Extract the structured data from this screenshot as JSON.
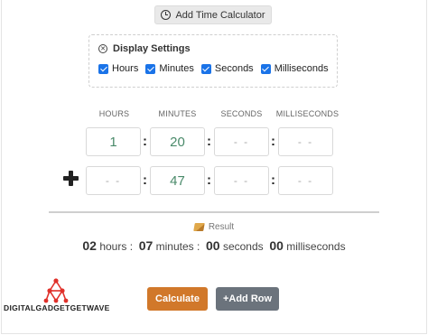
{
  "toolbar": {
    "add_time_calculator_label": "Add Time Calculator"
  },
  "settings": {
    "title": "Display Settings",
    "options": [
      {
        "label": "Hours",
        "checked": true
      },
      {
        "label": "Minutes",
        "checked": true
      },
      {
        "label": "Seconds",
        "checked": true
      },
      {
        "label": "Milliseconds",
        "checked": true
      }
    ]
  },
  "columns": [
    "HOURS",
    "MINUTES",
    "SECONDS",
    "MILLISECONDS"
  ],
  "rows": [
    {
      "operator": "",
      "hours": "1",
      "minutes": "20",
      "seconds": "- -",
      "milliseconds": "- -"
    },
    {
      "operator": "plus",
      "hours": "- -",
      "minutes": "47",
      "seconds": "- -",
      "milliseconds": "- -"
    }
  ],
  "separator": ":",
  "result": {
    "label": "Result",
    "hours_value": "02",
    "hours_unit": "hours",
    "minutes_value": "07",
    "minutes_unit": "minutes",
    "seconds_value": "00",
    "seconds_unit": "seconds",
    "ms_value": "00",
    "ms_unit": "milliseconds",
    "sep": ":"
  },
  "actions": {
    "calculate_label": "Calculate",
    "add_row_label": "+Add Row"
  },
  "brand": {
    "logo_text": "DIGITALGADGETGETWAVE",
    "accent": "#e0302a"
  },
  "colors": {
    "calculate_bg": "#d1782a",
    "add_row_bg": "#6b737c",
    "checkbox": "#1a73e8",
    "value_text": "#4a8a6a"
  }
}
